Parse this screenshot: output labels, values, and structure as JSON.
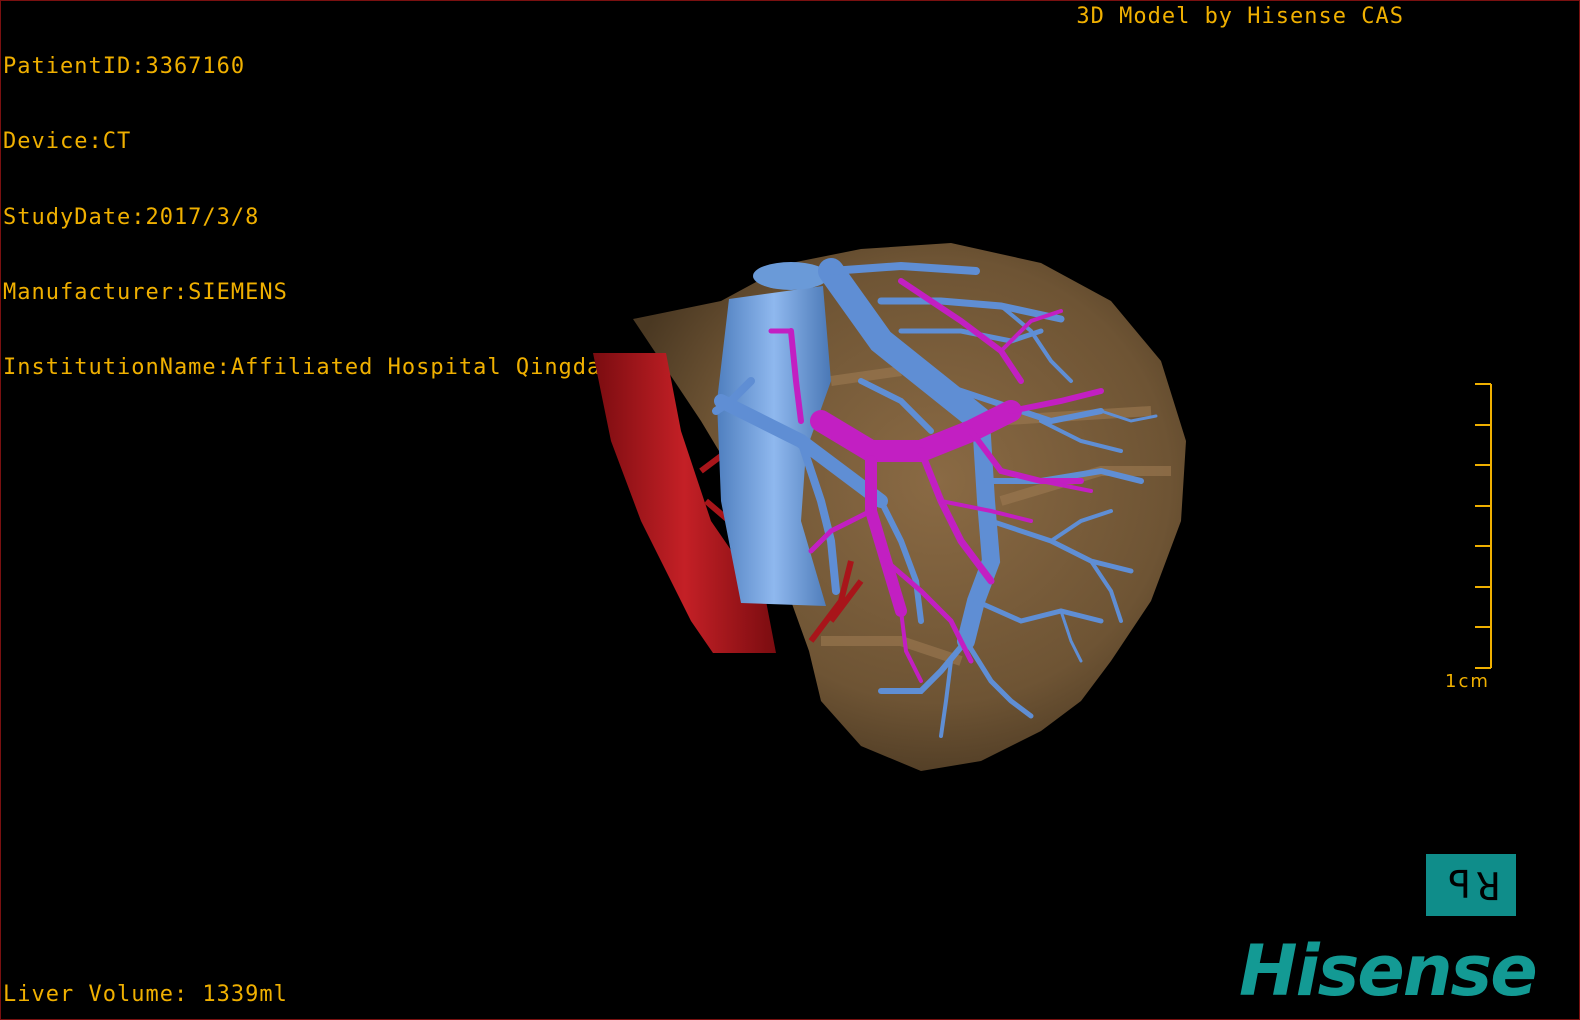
{
  "overlay": {
    "patient_id": "PatientID:3367160",
    "device": "Device:CT",
    "study_date": "StudyDate:2017/3/8",
    "manufacturer": "Manufacturer:SIEMENS",
    "institution": "InstitutionName:Affiliated Hospital Qingdao University-C",
    "credit": "3D Model by Hisense CAS",
    "liver_volume": "Liver Volume: 1339ml"
  },
  "scale_bar": {
    "label": "1cm",
    "tick_count": 8,
    "color": "#f0b000"
  },
  "orientation_cube": {
    "letter_left": "P",
    "letter_right": "R",
    "color": "#0f8d8a"
  },
  "logo": {
    "text": "Hisense",
    "color": "#139a94"
  },
  "model": {
    "structures": [
      {
        "name": "liver",
        "color": "#7a5d3c"
      },
      {
        "name": "inferior vena cava",
        "color": "#6b9ad8"
      },
      {
        "name": "hepatic veins",
        "color": "#5f8ed4"
      },
      {
        "name": "portal vein",
        "color": "#c21fc2"
      },
      {
        "name": "aorta",
        "color": "#a8151a"
      }
    ]
  }
}
